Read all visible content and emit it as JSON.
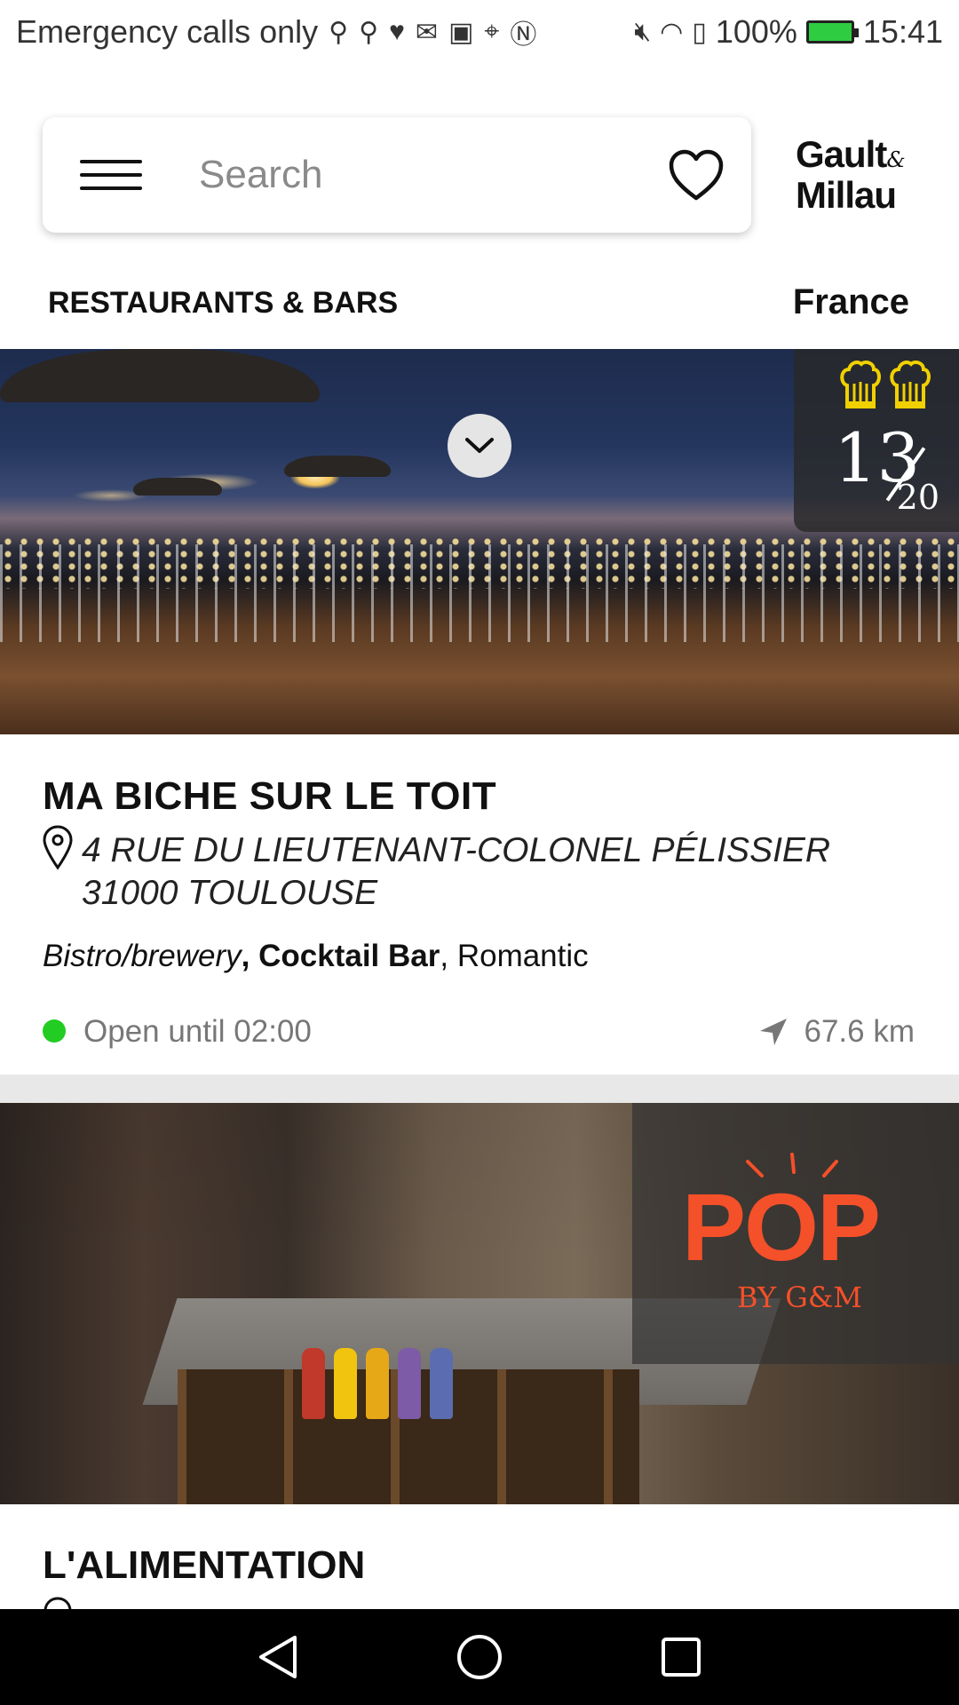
{
  "status_bar": {
    "carrier": "Emergency calls only",
    "battery": "100%",
    "time": "15:41"
  },
  "search": {
    "placeholder": "Search"
  },
  "logo": {
    "line1": "Gault",
    "amp": "&",
    "line2": "Millau"
  },
  "category": "RESTAURANTS & BARS",
  "country": "France",
  "cards": [
    {
      "score": "13",
      "score_max": "20",
      "title": "MA BICHE SUR LE TOIT",
      "address_line1": "4 RUE DU LIEUTENANT-COLONEL PÉLISSIER",
      "address_line2": "31000 TOULOUSE",
      "tag_italic": "Bistro/brewery",
      "tag_bold": ", Cocktail Bar",
      "tag_regular": ", Romantic",
      "hours": "Open until 02:00",
      "distance": "67.6 km"
    },
    {
      "badge_main": "POP",
      "badge_sub": "BY G&M",
      "title": "L'ALIMENTATION"
    }
  ],
  "colors": {
    "open_status": "#22cc22",
    "pop_orange": "#f4502a",
    "toque_yellow": "#f0d000"
  }
}
